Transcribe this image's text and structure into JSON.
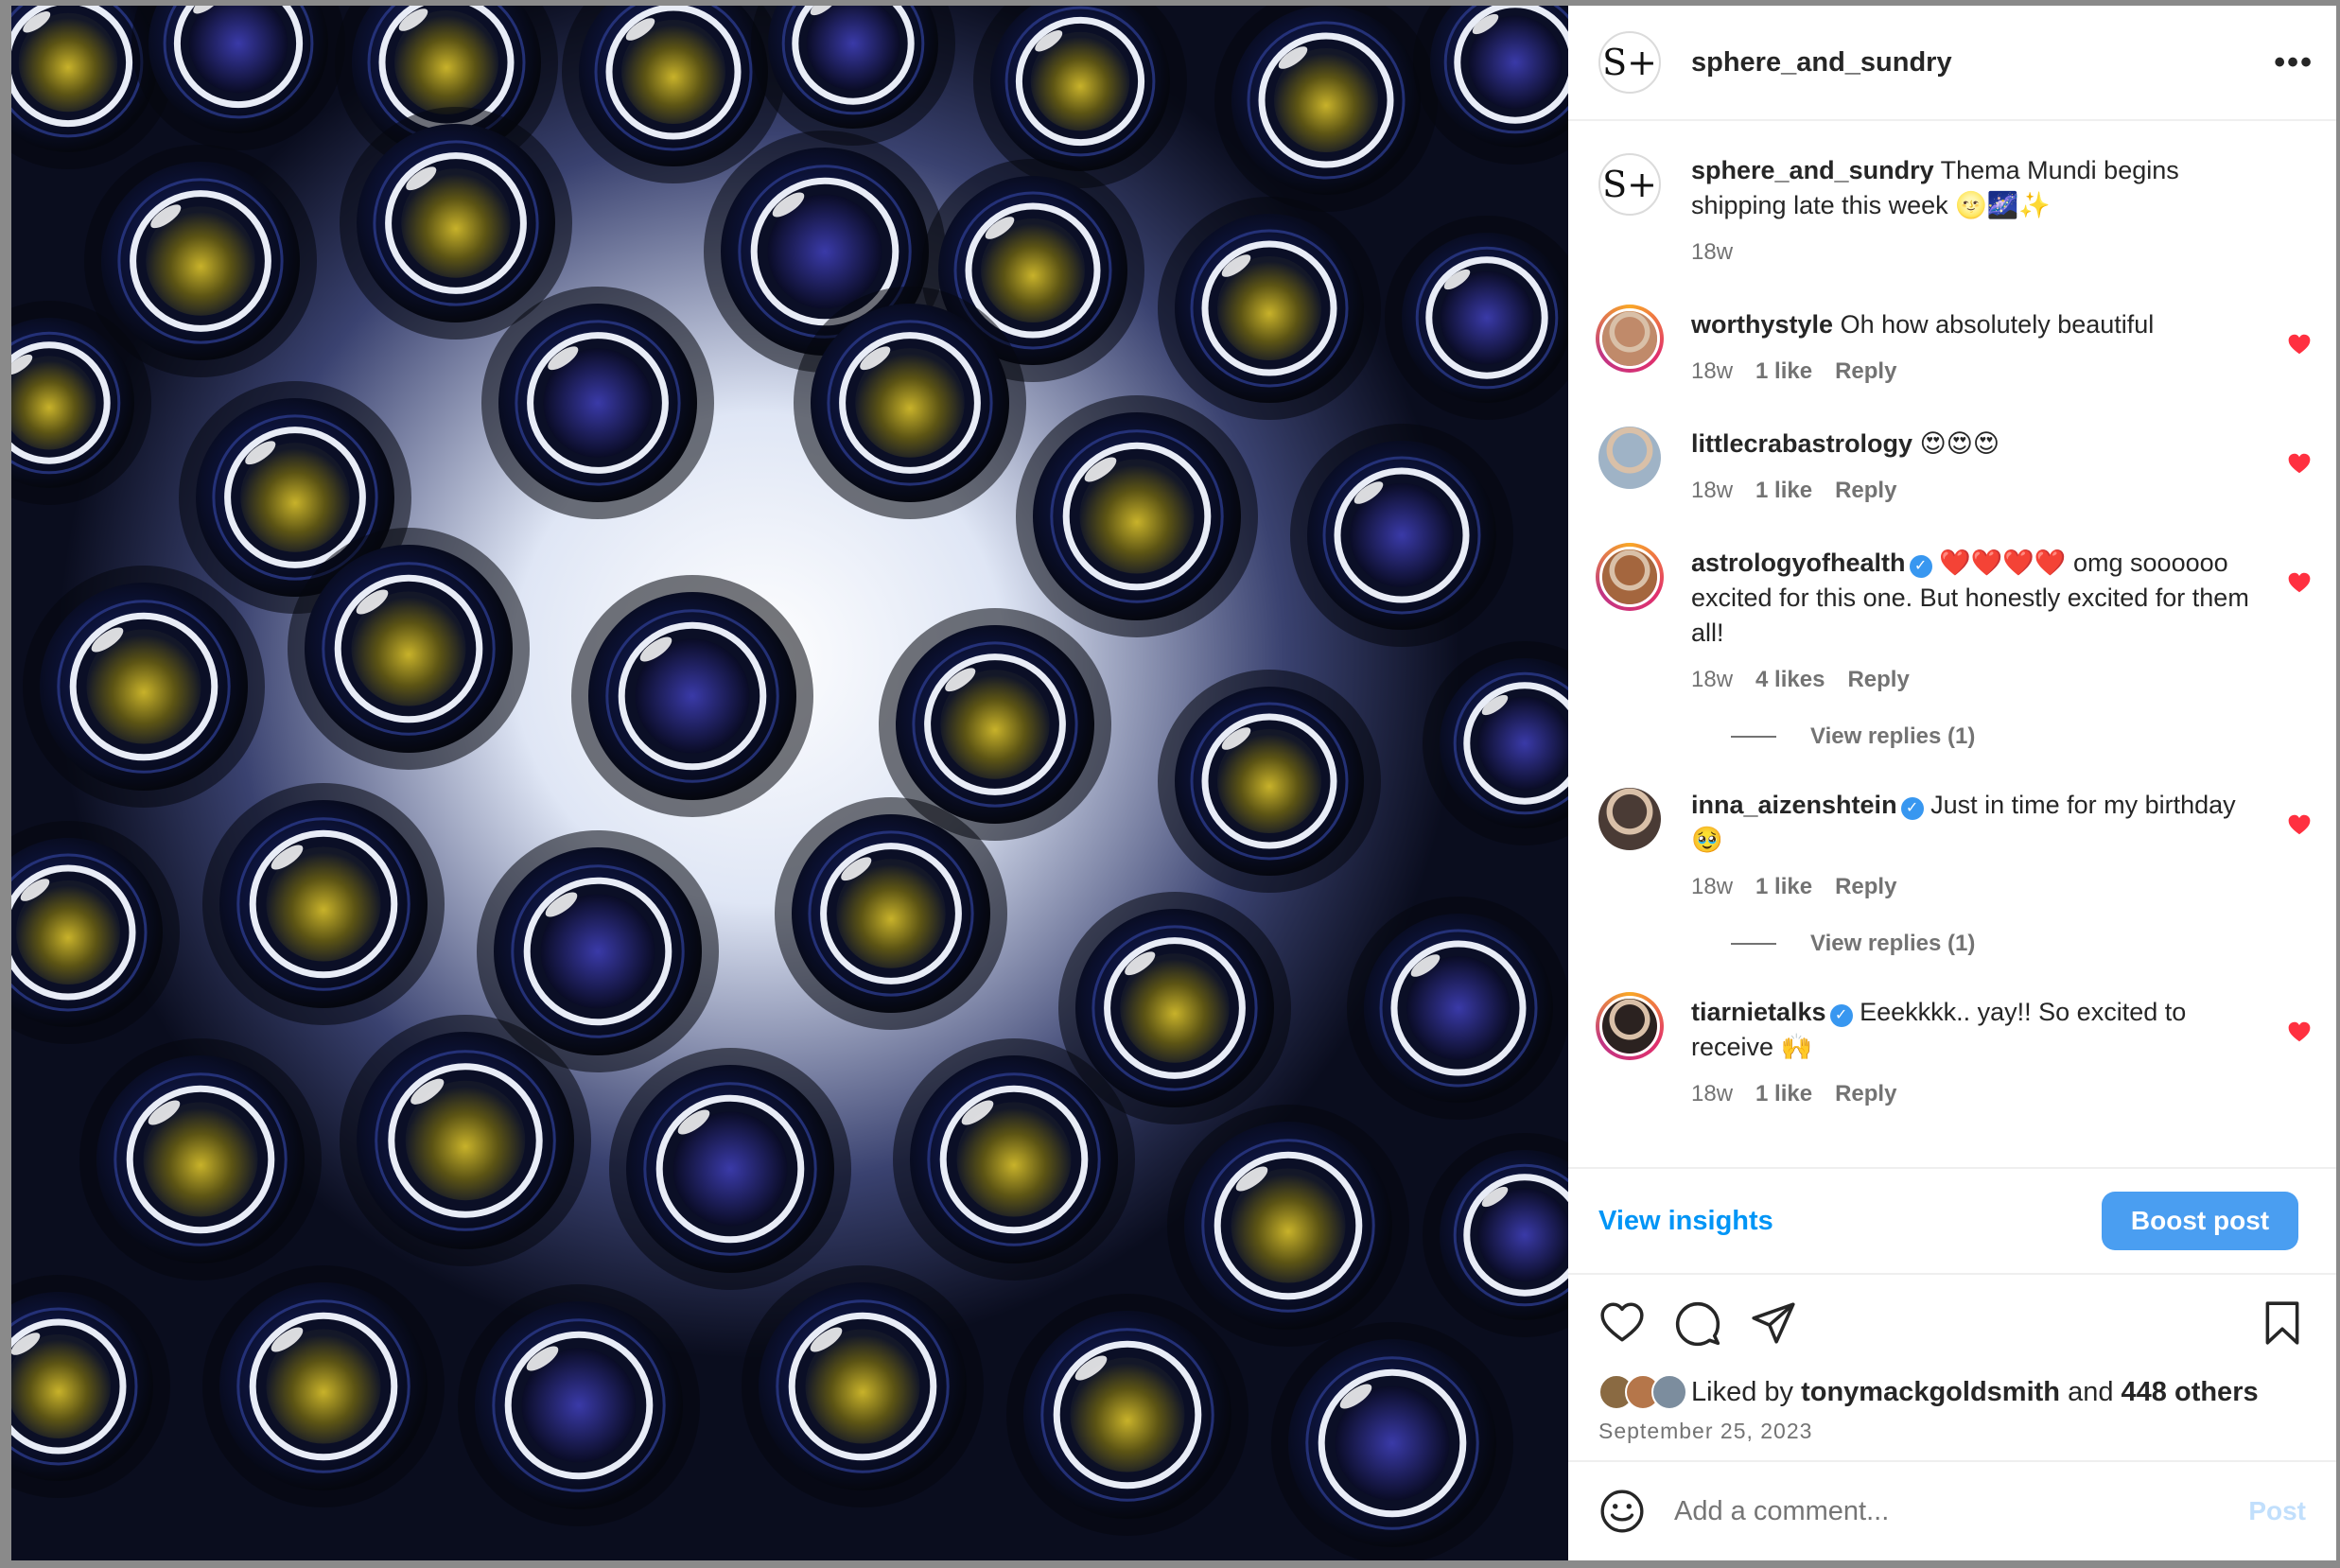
{
  "post": {
    "author": "sphere_and_sundry",
    "avatar_text": "S+",
    "more_label": "•••",
    "caption": {
      "username": "sphere_and_sundry",
      "text": "Thema Mundi begins shipping late this week 🌝🌌✨",
      "time": "18w"
    },
    "comments": [
      {
        "username": "worthystyle",
        "verified": false,
        "text": "Oh how absolutely beautiful",
        "time": "18w",
        "likes": "1 like",
        "reply": "Reply",
        "story_ring": true,
        "face_color": "#c08a6a"
      },
      {
        "username": "littlecrabastrology",
        "verified": false,
        "text": "😍😍😍",
        "time": "18w",
        "likes": "1 like",
        "reply": "Reply",
        "story_ring": false,
        "face_color": "#9fb3c6"
      },
      {
        "username": "astrologyofhealth",
        "verified": true,
        "text": "❤️❤️❤️❤️ omg soooooo excited for this one. But honestly excited for them all!",
        "time": "18w",
        "likes": "4 likes",
        "reply": "Reply",
        "story_ring": true,
        "face_color": "#a4663e",
        "view_replies": "View replies (1)"
      },
      {
        "username": "inna_aizenshtein",
        "verified": true,
        "text": "Just in time for my birthday 🥹",
        "time": "18w",
        "likes": "1 like",
        "reply": "Reply",
        "story_ring": false,
        "face_color": "#4a3b35",
        "view_replies": "View replies (1)"
      },
      {
        "username": "tiarnietalks",
        "verified": true,
        "text": "Eeekkkk.. yay!! So excited to receive 🙌",
        "time": "18w",
        "likes": "1 like",
        "reply": "Reply",
        "story_ring": true,
        "face_color": "#2b2220"
      }
    ],
    "view_insights": "View insights",
    "boost_post": "Boost post",
    "liked_by_prefix": "Liked by",
    "liked_by_user": "tonymackgoldsmith",
    "liked_by_and": "and",
    "liked_by_others": "448 others",
    "date": "September 25, 2023",
    "comment_placeholder": "Add a comment...",
    "post_button": "Post"
  },
  "colors": {
    "accent": "#0095f6",
    "boost": "#4a9ef1",
    "heart": "#ff3040",
    "muted": "#737373"
  },
  "icons": [
    "like-icon",
    "comment-icon",
    "share-icon",
    "save-icon",
    "emoji-icon",
    "more-icon",
    "verified-icon"
  ]
}
